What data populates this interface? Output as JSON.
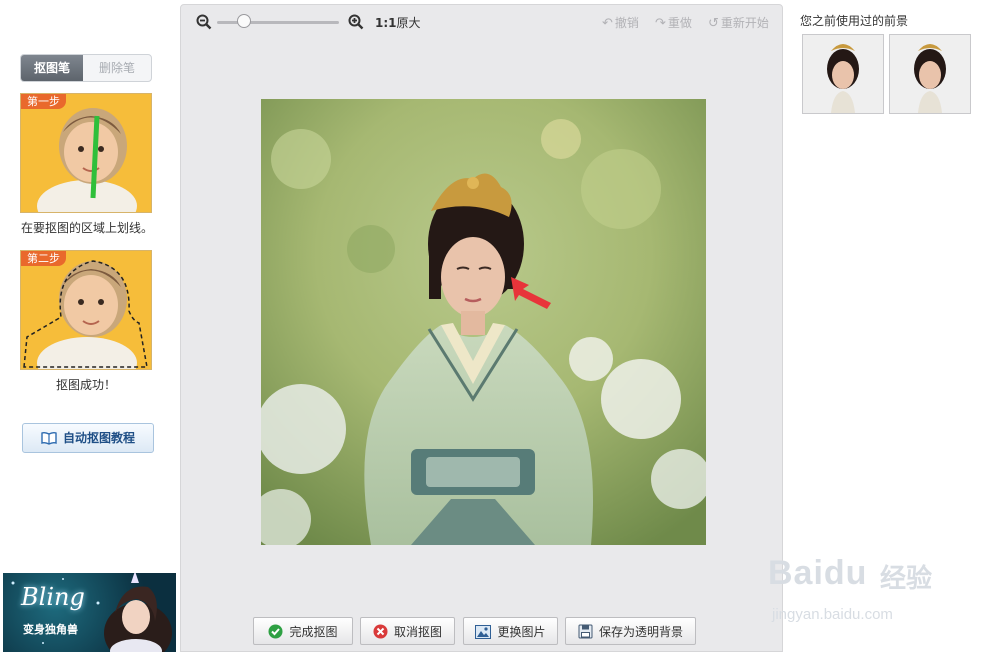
{
  "left_panel": {
    "tool_active": "抠图笔",
    "tool_inactive": "删除笔",
    "step1_badge": "第一步",
    "step1_text": "在要抠图的区域上划线。",
    "step2_badge": "第二步",
    "step2_text": "抠图成功！",
    "tutorial_button": "自动抠图教程",
    "ad_title": "Bling",
    "ad_subtitle": "变身独角兽"
  },
  "toolbar": {
    "zoom_level": 0.22,
    "original_size_bold": "1:1",
    "original_size": "原大",
    "undo": "撤销",
    "redo": "重做",
    "restart": "重新开始"
  },
  "actions": {
    "done": "完成抠图",
    "cancel": "取消抠图",
    "change_image": "更换图片",
    "save_transparent": "保存为透明背景"
  },
  "right_panel": {
    "title": "您之前使用过的前景"
  },
  "watermark": {
    "logo": "Baidu",
    "cn": "经验",
    "url": "jingyan.baidu.com"
  },
  "colors": {
    "accent_orange": "#e9692c",
    "button_blue": "#1f4f86",
    "arrow_red": "#e8343a"
  }
}
